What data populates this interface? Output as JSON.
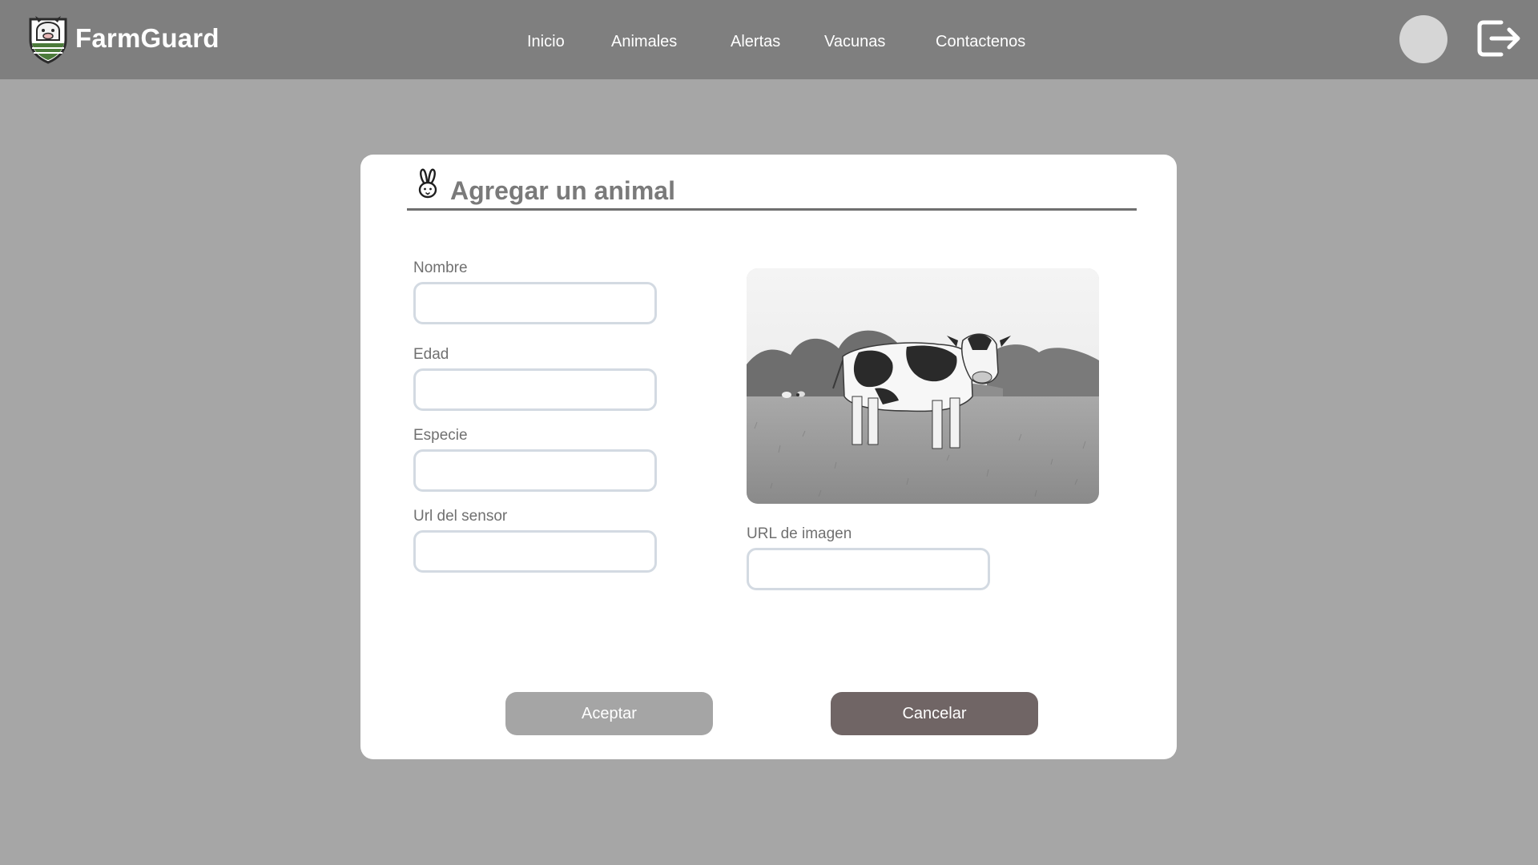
{
  "app": {
    "name": "FarmGuard"
  },
  "nav": {
    "links": [
      "Inicio",
      "Animales",
      "Alertas",
      "Vacunas",
      "Contactenos"
    ]
  },
  "modal": {
    "title": "Agregar un animal",
    "fields": {
      "nombre": {
        "label": "Nombre",
        "value": ""
      },
      "edad": {
        "label": "Edad",
        "value": ""
      },
      "especie": {
        "label": "Especie",
        "value": ""
      },
      "sensor_url": {
        "label": "Url del sensor",
        "value": ""
      },
      "image_url": {
        "label": "URL de imagen",
        "value": ""
      }
    },
    "buttons": {
      "accept": "Aceptar",
      "cancel": "Cancelar"
    }
  },
  "colors": {
    "navbar": "#7f7f7f",
    "backdrop": "#a6a6a6",
    "accept_button": "#a5a5a5",
    "cancel_button": "#706565",
    "input_border": "#d3dae2"
  },
  "icons": {
    "brand": "farm-shield-icon",
    "title": "rabbit-icon",
    "avatar": "user-avatar",
    "logout": "logout-icon"
  }
}
